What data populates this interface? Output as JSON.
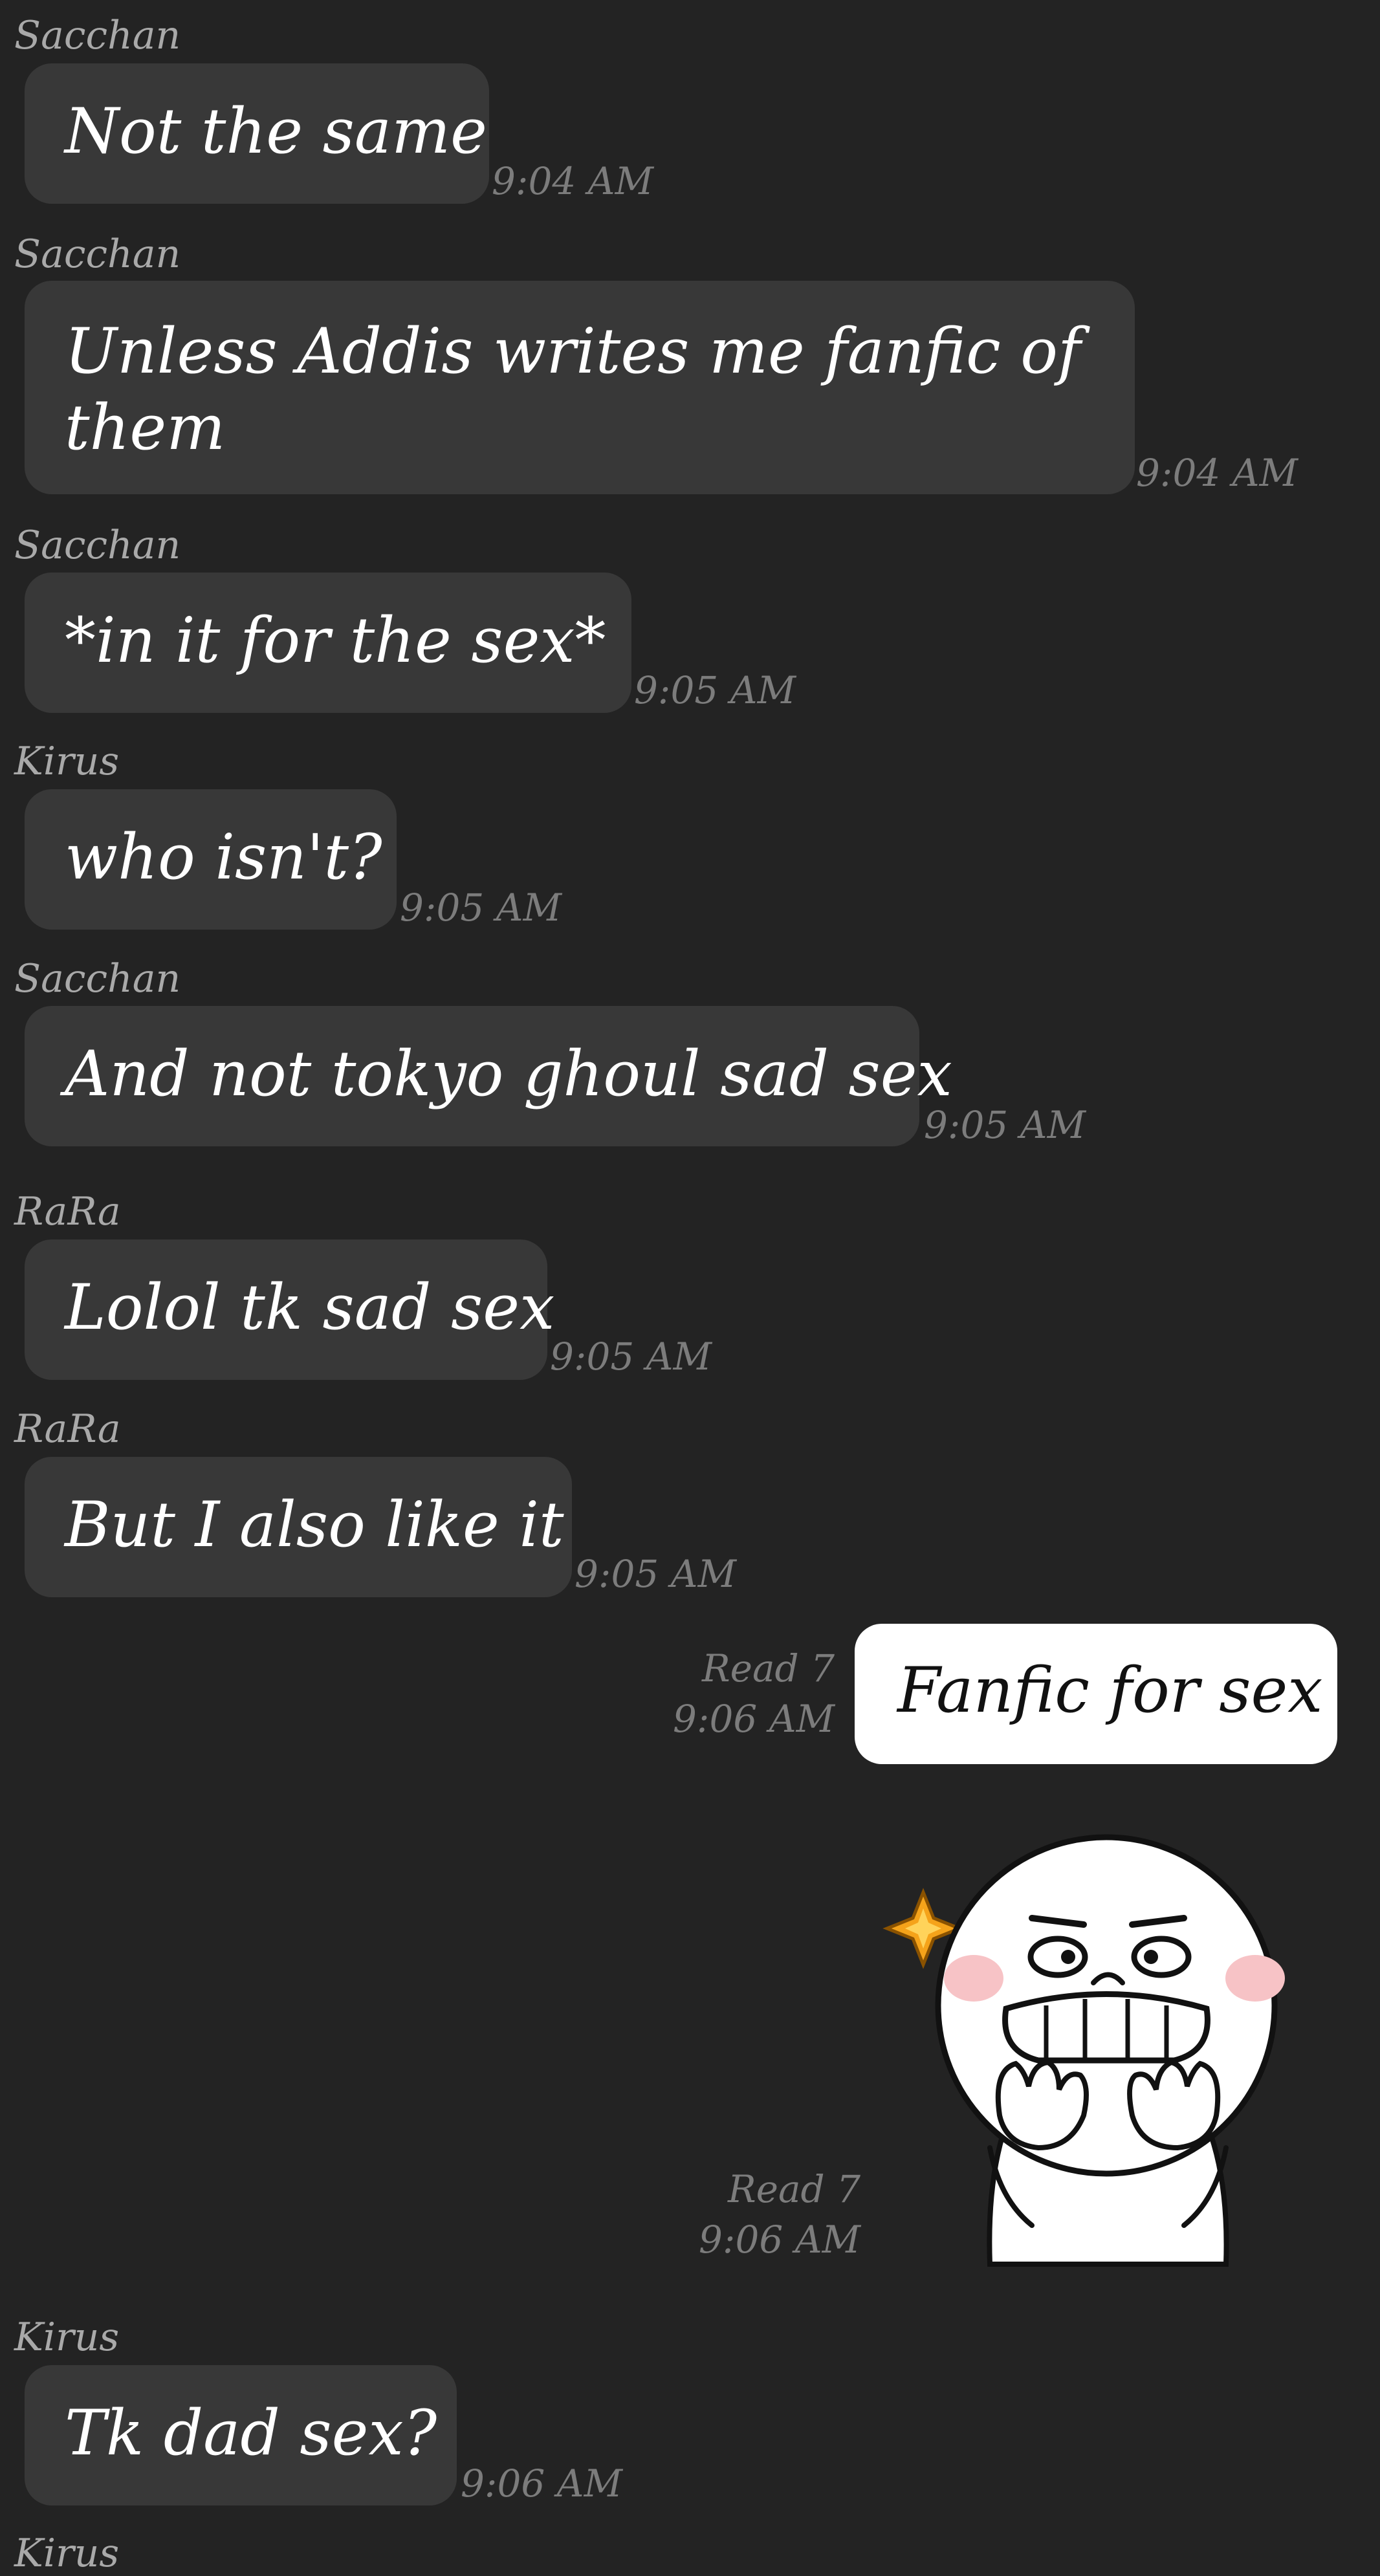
{
  "messages": [
    {
      "sender": "Sacchan",
      "text": "Not the same",
      "time": "9:04 AM"
    },
    {
      "sender": "Sacchan",
      "text": "Unless Addis writes me fanfic of them",
      "time": "9:04 AM"
    },
    {
      "sender": "Sacchan",
      "text": "*in it for the sex*",
      "time": "9:05 AM"
    },
    {
      "sender": "Kirus",
      "text": "who isn't?",
      "time": "9:05 AM"
    },
    {
      "sender": "Sacchan",
      "text": "And not tokyo ghoul sad sex",
      "time": "9:05 AM"
    },
    {
      "sender": "RaRa",
      "text": "Lolol tk sad sex",
      "time": "9:05 AM"
    },
    {
      "sender": "RaRa",
      "text": "But I also like it",
      "time": "9:05 AM"
    },
    {
      "sender": "Kirus",
      "text": "Tk dad sex?",
      "time": "9:06 AM"
    }
  ],
  "outgoing": {
    "text": "Fanfic for sex",
    "read": "Read 7",
    "time": "9:06 AM"
  },
  "sticker": {
    "icon": "moon-grinning-sticker",
    "read": "Read 7",
    "time": "9:06 AM"
  },
  "next_sender": "Kirus",
  "colors": {
    "background": "#232323",
    "incoming_bubble": "#383838",
    "outgoing_bubble": "#ffffff",
    "sender_text": "#a9a9a9",
    "timestamp": "#7c7c7c"
  }
}
